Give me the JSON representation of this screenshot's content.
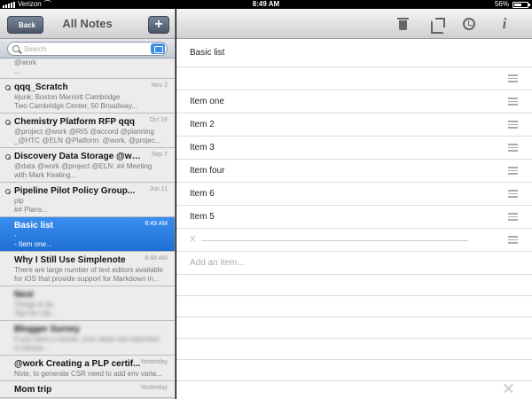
{
  "status_bar": {
    "carrier": "Verizon",
    "time": "8:49 AM",
    "battery": "56%",
    "battery_level": 0.56
  },
  "sidebar": {
    "back_label": "Back",
    "title": "All Notes",
    "add_label": "+",
    "search": {
      "placeholder": "Search"
    },
    "notes": [
      {
        "title": "",
        "lines": [
          "@work",
          "..."
        ],
        "date": "",
        "pinned": false,
        "selected": false,
        "blurred": false
      },
      {
        "title": "qqq_Scratch",
        "lines": [
          "#junk:  Boston Marriott Cambridge",
          "    Two Cambridge Center, 50 Broadway..."
        ],
        "date": "Nov 2",
        "pinned": true,
        "selected": false,
        "blurred": false
      },
      {
        "title": "Chemistry Platform RFP qqq",
        "lines": [
          "@project @work @RIS @accord @planning",
          "_@HTC @ELN @Platform:  @work, @projec..."
        ],
        "date": "Oct 16",
        "pinned": true,
        "selected": false,
        "blurred": false
      },
      {
        "title": "Discovery Data Storage @work...",
        "lines": [
          "@data @work @project @ELN:  ## Meeting",
          "with Mark Keating..."
        ],
        "date": "Sep 7",
        "pinned": true,
        "selected": false,
        "blurred": false
      },
      {
        "title": "Pipeline Pilot Policy Group...",
        "lines": [
          "plp",
          "## Plans..."
        ],
        "date": "Jun 11",
        "pinned": true,
        "selected": false,
        "blurred": false
      },
      {
        "title": "Basic list",
        "lines": [
          "-",
          "- Item one..."
        ],
        "date": "8:49 AM",
        "pinned": false,
        "selected": true,
        "blurred": false
      },
      {
        "title": "Why I Still Use Simplenote",
        "lines": [
          "There are large number of text editors available",
          "for iOS that provide support for Markdown in..."
        ],
        "date": "8:48 AM",
        "pinned": false,
        "selected": false,
        "blurred": false
      },
      {
        "title": "Nest",
        "lines": [
          "Things to do",
          "Tips for Life..."
        ],
        "date": "",
        "pinned": false,
        "selected": false,
        "blurred": true
      },
      {
        "title": "Blogger Survey",
        "lines": [
          "If you have a minute, your views are important",
          "or please..."
        ],
        "date": "",
        "pinned": false,
        "selected": false,
        "blurred": true
      },
      {
        "title": "@work Creating a PLP certif...",
        "lines": [
          "",
          "Note, to generate CSR need to add env varia..."
        ],
        "date": "Yesterday",
        "pinned": false,
        "selected": false,
        "blurred": false
      },
      {
        "title": "Mom trip",
        "lines": [
          ""
        ],
        "date": "Yesterday",
        "pinned": false,
        "selected": false,
        "blurred": false
      }
    ]
  },
  "main": {
    "note_title": "Basic list",
    "items": [
      {
        "text": "",
        "deleted": false
      },
      {
        "text": "Item one",
        "deleted": false
      },
      {
        "text": "Item 2",
        "deleted": false
      },
      {
        "text": "Item 3",
        "deleted": false
      },
      {
        "text": "Item four",
        "deleted": false
      },
      {
        "text": "Item 6",
        "deleted": false
      },
      {
        "text": "Item 5",
        "deleted": false
      },
      {
        "text": "X",
        "deleted": true
      }
    ],
    "add_item_placeholder": "Add an item...",
    "toolbar_icons": [
      "trash-icon",
      "share-icon",
      "clock-icon",
      "info-icon"
    ]
  }
}
